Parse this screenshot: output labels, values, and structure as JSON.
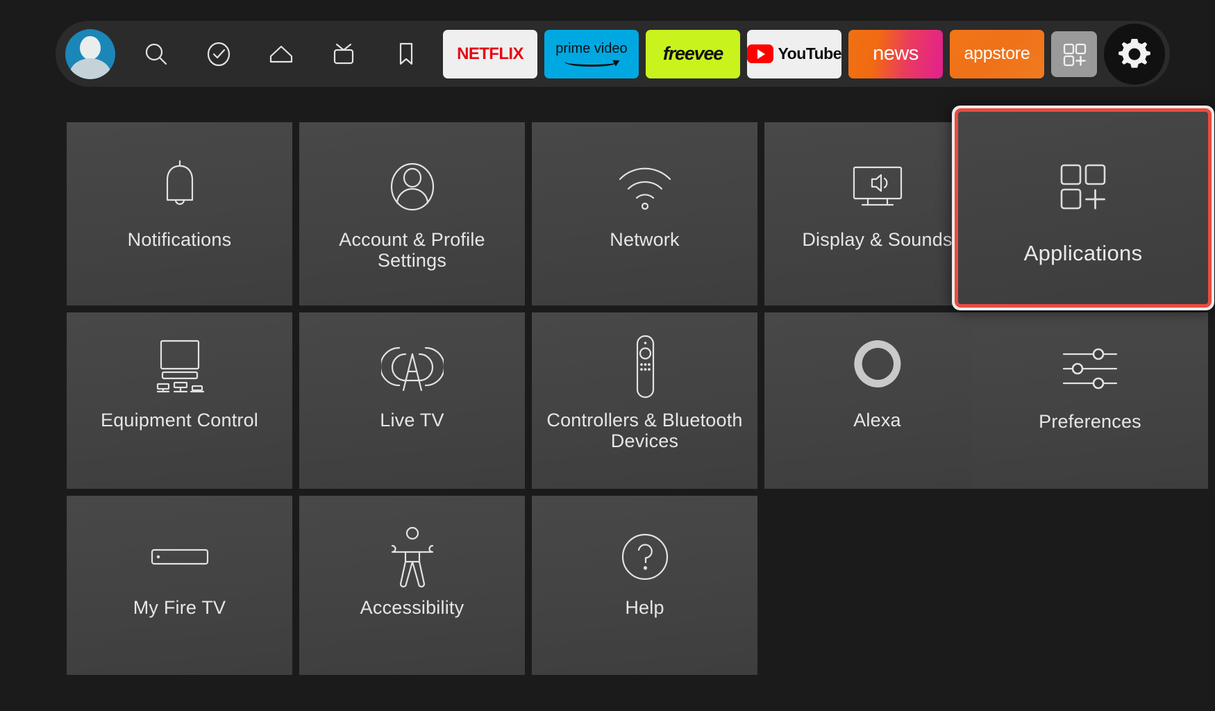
{
  "theme": {
    "background": "#1b1b1b",
    "navbar_bg": "#2b2b2b",
    "tile_bg": "#444444",
    "text": "#e6e6e6",
    "focus_border": "#ea4b42",
    "focus_outer": "#e9e9e9",
    "avatar_blue": "#1b86b8"
  },
  "topnav": {
    "avatar": {
      "name": "profile-avatar",
      "icon": "avatar-icon"
    },
    "icons": [
      {
        "name": "search",
        "icon": "search-icon"
      },
      {
        "name": "watchlist-check",
        "icon": "check-circle-icon"
      },
      {
        "name": "home",
        "icon": "home-icon"
      },
      {
        "name": "live-tv",
        "icon": "live-tv-icon"
      },
      {
        "name": "bookmark",
        "icon": "bookmark-icon"
      }
    ],
    "apps": [
      {
        "id": "netflix",
        "label": "NETFLIX",
        "bg": "#efefef"
      },
      {
        "id": "prime",
        "label": "prime video",
        "bg": "#00a8e1"
      },
      {
        "id": "freevee",
        "label": "freevee",
        "bg": "#c9f31d"
      },
      {
        "id": "youtube",
        "label": "YouTube",
        "bg": "#efefef"
      },
      {
        "id": "news",
        "label": "news",
        "bg": "#ea3b5e"
      },
      {
        "id": "appstore",
        "label": "appstore",
        "bg": "#f27617"
      }
    ],
    "apps_grid_button": {
      "name": "apps-grid-button",
      "icon": "apps-grid-plus-icon"
    },
    "settings_button": {
      "name": "settings-gear-button",
      "icon": "gear-icon"
    }
  },
  "settings_grid": {
    "rows": [
      [
        {
          "label": "Notifications",
          "icon": "bell-icon"
        },
        {
          "label": "Account & Profile Settings",
          "icon": "person-circle-icon"
        },
        {
          "label": "Network",
          "icon": "wifi-icon"
        },
        {
          "label": "Display & Sounds",
          "icon": "tv-speaker-icon"
        }
      ],
      [
        {
          "label": "Equipment Control",
          "icon": "tv-equipment-icon"
        },
        {
          "label": "Live TV",
          "icon": "broadcast-tower-icon"
        },
        {
          "label": "Controllers & Bluetooth Devices",
          "icon": "remote-control-icon"
        },
        {
          "label": "Alexa",
          "icon": "alexa-ring-icon"
        }
      ],
      [
        {
          "label": "My Fire TV",
          "icon": "fire-tv-stick-icon"
        },
        {
          "label": "Accessibility",
          "icon": "accessibility-person-icon"
        },
        {
          "label": "Help",
          "icon": "question-circle-icon"
        }
      ]
    ],
    "preferences_tile": {
      "label": "Preferences",
      "icon": "sliders-icon"
    },
    "focused_tile": {
      "label": "Applications",
      "icon": "apps-grid-plus-icon",
      "focused": true
    }
  }
}
